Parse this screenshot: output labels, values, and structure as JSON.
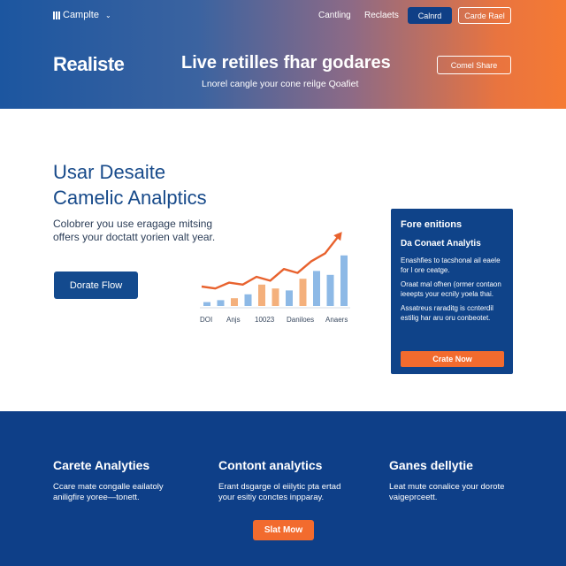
{
  "topbar": {
    "logo_text": "Camplte",
    "nav_links": [
      "Cantling",
      "Reclaets"
    ],
    "button_primary": "Calnrd",
    "button_outline": "Carde Rael"
  },
  "hero": {
    "brand": "Realiste",
    "title": "Live retilles fhar godares",
    "subtitle": "Lnorel cangle your cone reilge Qoafiet",
    "button": "Comel Share"
  },
  "main": {
    "title_line1": "Usar Desaite",
    "title_line2": "Camelic Analptics",
    "description_line1": "Colobrer you use eragage mitsing",
    "description_line2": "offers your doctatt yorien valt year.",
    "button": "Dorate Flow"
  },
  "chart_data": {
    "type": "bar",
    "categories": [
      "DOI",
      "Anjs",
      "10023",
      "Daniloes",
      "Anaers"
    ],
    "series": [
      {
        "values": [
          2,
          3,
          4,
          6,
          11,
          9,
          8,
          14,
          18,
          16,
          26
        ]
      },
      {
        "type": "line",
        "values": [
          10,
          9,
          12,
          11,
          15,
          13,
          19,
          17,
          23,
          27,
          36
        ]
      }
    ],
    "colors": {
      "bars_blue": "#8db9e6",
      "bars_orange": "#f4b07c",
      "line": "#e8622e"
    }
  },
  "card": {
    "title": "Fore enitions",
    "subtitle": "Da Conaet Analytis",
    "paragraphs": [
      "Enashfies to tacshonal ail eaele for l ore ceatge.",
      "Oraat mal ofhen (ormer contaon ieeepts your ecnily yoela thai.",
      "Assatreus raraditg is ccnterdil estilig har aru oru conbeotet."
    ],
    "button": "Crate Now"
  },
  "footer": {
    "features": [
      {
        "title": "Carete Analyties",
        "text_line1": "Ccare mate congalle eailatoly",
        "text_line2": "aniligfire yoree—tonett."
      },
      {
        "title": "Contont analytics",
        "text_line1": "Erant dsgarge ol eiilytic pta ertad",
        "text_line2": "your esitiy conctes inpparay."
      },
      {
        "title": "Ganes dellytie",
        "text_line1": "Leat mute conalice your dorote",
        "text_line2": "vaigeprceett."
      }
    ],
    "cta": "Slat Mow"
  },
  "colors": {
    "accent_orange": "#f26b2e",
    "brand_blue": "#0e3f88",
    "heading_blue": "#174a8a"
  }
}
